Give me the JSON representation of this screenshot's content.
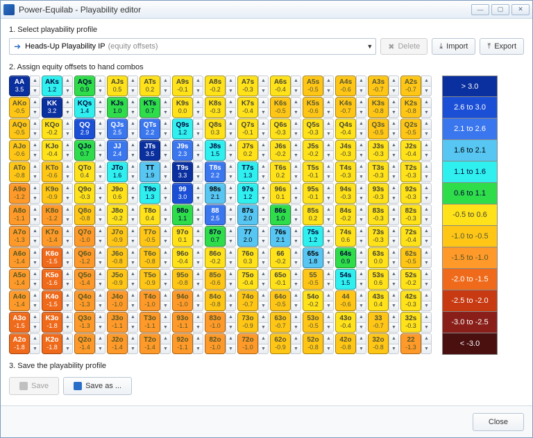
{
  "window": {
    "title": "Power-Equilab - Playability editor"
  },
  "section1": {
    "label": "1. Select playability profile",
    "profile_name": "Heads-Up Playability IP",
    "profile_suffix": "(equity offsets)",
    "delete_label": "Delete",
    "import_label": "Import",
    "export_label": "Export"
  },
  "section2": {
    "label": "2. Assign equity offsets to hand combos"
  },
  "section3": {
    "label": "3. Save the playability profile",
    "save_label": "Save",
    "saveas_label": "Save as ..."
  },
  "footer": {
    "close_label": "Close"
  },
  "legend": [
    {
      "label": "> 3.0",
      "v": 3.5
    },
    {
      "label": "2.6 to 3.0",
      "v": 2.8
    },
    {
      "label": "2.1 to 2.6",
      "v": 2.3
    },
    {
      "label": "1.6 to 2.1",
      "v": 1.8
    },
    {
      "label": "1.1 to 1.6",
      "v": 1.3
    },
    {
      "label": "0.6 to 1.1",
      "v": 0.8
    },
    {
      "label": "-0.5 to 0.6",
      "v": 0.0
    },
    {
      "label": "-1.0 to -0.5",
      "v": -0.7
    },
    {
      "label": "-1.5 to -1.0",
      "v": -1.2
    },
    {
      "label": "-2.0 to -1.5",
      "v": -1.7
    },
    {
      "label": "-2.5 to -2.0",
      "v": -2.2
    },
    {
      "label": "-3.0 to -2.5",
      "v": -2.7
    },
    {
      "label": "< -3.0",
      "v": -3.5
    }
  ],
  "chart_data": {
    "type": "heatmap",
    "title": "Equity offsets by hand combo",
    "rows": [
      "A",
      "K",
      "Q",
      "J",
      "T",
      "9",
      "8",
      "7",
      "6",
      "5",
      "4",
      "3",
      "2"
    ],
    "cols": [
      "A",
      "K",
      "Q",
      "J",
      "T",
      "9",
      "8",
      "7",
      "6",
      "5",
      "4",
      "3",
      "2"
    ],
    "note": "diagonal = pairs, upper-right = suited (s), lower-left = offsuit (o); value is equity offset",
    "grid": [
      [
        {
          "h": "AA",
          "v": 3.5
        },
        {
          "h": "AKs",
          "v": 1.2
        },
        {
          "h": "AQs",
          "v": 0.9
        },
        {
          "h": "AJs",
          "v": 0.5
        },
        {
          "h": "ATs",
          "v": 0.2
        },
        {
          "h": "A9s",
          "v": -0.1
        },
        {
          "h": "A8s",
          "v": -0.2
        },
        {
          "h": "A7s",
          "v": -0.3
        },
        {
          "h": "A6s",
          "v": -0.4
        },
        {
          "h": "A5s",
          "v": -0.5
        },
        {
          "h": "A4s",
          "v": -0.6
        },
        {
          "h": "A3s",
          "v": -0.7
        },
        {
          "h": "A2s",
          "v": -0.7
        }
      ],
      [
        {
          "h": "AKo",
          "v": -0.5
        },
        {
          "h": "KK",
          "v": 3.2
        },
        {
          "h": "KQs",
          "v": 1.4
        },
        {
          "h": "KJs",
          "v": 1.0
        },
        {
          "h": "KTs",
          "v": 0.7
        },
        {
          "h": "K9s",
          "v": 0.0
        },
        {
          "h": "K8s",
          "v": -0.3
        },
        {
          "h": "K7s",
          "v": -0.4
        },
        {
          "h": "K6s",
          "v": -0.5
        },
        {
          "h": "K5s",
          "v": -0.6
        },
        {
          "h": "K4s",
          "v": -0.7
        },
        {
          "h": "K3s",
          "v": -0.8
        },
        {
          "h": "K2s",
          "v": -0.8
        }
      ],
      [
        {
          "h": "AQo",
          "v": -0.5
        },
        {
          "h": "KQo",
          "v": -0.2
        },
        {
          "h": "QQ",
          "v": 2.9
        },
        {
          "h": "QJs",
          "v": 2.5
        },
        {
          "h": "QTs",
          "v": 2.2
        },
        {
          "h": "Q9s",
          "v": 1.2
        },
        {
          "h": "Q8s",
          "v": 0.3
        },
        {
          "h": "Q7s",
          "v": -0.1
        },
        {
          "h": "Q6s",
          "v": -0.3
        },
        {
          "h": "Q5s",
          "v": -0.3
        },
        {
          "h": "Q4s",
          "v": -0.4
        },
        {
          "h": "Q3s",
          "v": -0.5
        },
        {
          "h": "Q2s",
          "v": -0.5
        }
      ],
      [
        {
          "h": "AJo",
          "v": -0.6
        },
        {
          "h": "KJo",
          "v": -0.4
        },
        {
          "h": "QJo",
          "v": 0.7
        },
        {
          "h": "JJ",
          "v": 2.4
        },
        {
          "h": "JTs",
          "v": 3.5
        },
        {
          "h": "J9s",
          "v": 2.3
        },
        {
          "h": "J8s",
          "v": 1.5
        },
        {
          "h": "J7s",
          "v": 0.2
        },
        {
          "h": "J6s",
          "v": -0.2
        },
        {
          "h": "J5s",
          "v": -0.2
        },
        {
          "h": "J4s",
          "v": -0.3
        },
        {
          "h": "J3s",
          "v": -0.3
        },
        {
          "h": "J2s",
          "v": -0.4
        }
      ],
      [
        {
          "h": "ATo",
          "v": -0.8
        },
        {
          "h": "KTo",
          "v": -0.6
        },
        {
          "h": "QTo",
          "v": 0.4
        },
        {
          "h": "JTo",
          "v": 1.6
        },
        {
          "h": "TT",
          "v": 1.9
        },
        {
          "h": "T9s",
          "v": 3.3
        },
        {
          "h": "T8s",
          "v": 2.2
        },
        {
          "h": "T7s",
          "v": 1.3
        },
        {
          "h": "T6s",
          "v": 0.2
        },
        {
          "h": "T5s",
          "v": -0.1
        },
        {
          "h": "T4s",
          "v": -0.3
        },
        {
          "h": "T3s",
          "v": -0.3
        },
        {
          "h": "T2s",
          "v": -0.3
        }
      ],
      [
        {
          "h": "A9o",
          "v": -1.2
        },
        {
          "h": "K9o",
          "v": -0.9
        },
        {
          "h": "Q9o",
          "v": -0.3
        },
        {
          "h": "J9o",
          "v": 0.6
        },
        {
          "h": "T9o",
          "v": 1.3
        },
        {
          "h": "99",
          "v": 3.0
        },
        {
          "h": "98s",
          "v": 2.1
        },
        {
          "h": "97s",
          "v": 1.2
        },
        {
          "h": "96s",
          "v": 0.1
        },
        {
          "h": "95s",
          "v": -0.1
        },
        {
          "h": "94s",
          "v": -0.3
        },
        {
          "h": "93s",
          "v": -0.3
        },
        {
          "h": "92s",
          "v": -0.3
        }
      ],
      [
        {
          "h": "A8o",
          "v": -1.1
        },
        {
          "h": "K8o",
          "v": -1.2
        },
        {
          "h": "Q8o",
          "v": -0.8
        },
        {
          "h": "J8o",
          "v": -0.2
        },
        {
          "h": "T8o",
          "v": 0.4
        },
        {
          "h": "98o",
          "v": 1.1
        },
        {
          "h": "88",
          "v": 2.5
        },
        {
          "h": "87s",
          "v": 2.0
        },
        {
          "h": "86s",
          "v": 1.0
        },
        {
          "h": "85s",
          "v": 0.2
        },
        {
          "h": "84s",
          "v": -0.2
        },
        {
          "h": "83s",
          "v": -0.3
        },
        {
          "h": "82s",
          "v": -0.3
        }
      ],
      [
        {
          "h": "A7o",
          "v": -1.3
        },
        {
          "h": "K7o",
          "v": -1.4
        },
        {
          "h": "Q7o",
          "v": -1.0
        },
        {
          "h": "J7o",
          "v": -0.9
        },
        {
          "h": "T7o",
          "v": -0.5
        },
        {
          "h": "97o",
          "v": 0.1
        },
        {
          "h": "87o",
          "v": 0.7
        },
        {
          "h": "77",
          "v": 2.0
        },
        {
          "h": "76s",
          "v": 2.1
        },
        {
          "h": "75s",
          "v": 1.2
        },
        {
          "h": "74s",
          "v": 0.6
        },
        {
          "h": "73s",
          "v": -0.3
        },
        {
          "h": "72s",
          "v": -0.4
        }
      ],
      [
        {
          "h": "A6o",
          "v": -1.4
        },
        {
          "h": "K6o",
          "v": -1.5
        },
        {
          "h": "Q6o",
          "v": -1.2
        },
        {
          "h": "J6o",
          "v": -0.8
        },
        {
          "h": "T6o",
          "v": -0.8
        },
        {
          "h": "96o",
          "v": -0.4
        },
        {
          "h": "86o",
          "v": -0.2
        },
        {
          "h": "76o",
          "v": 0.3
        },
        {
          "h": "66",
          "v": -0.2
        },
        {
          "h": "65s",
          "v": 1.8
        },
        {
          "h": "64s",
          "v": 0.9
        },
        {
          "h": "63s",
          "v": 0.0
        },
        {
          "h": "62s",
          "v": -0.5
        }
      ],
      [
        {
          "h": "A5o",
          "v": -1.4
        },
        {
          "h": "K5o",
          "v": -1.6
        },
        {
          "h": "Q5o",
          "v": -1.4
        },
        {
          "h": "J5o",
          "v": -0.9
        },
        {
          "h": "T5o",
          "v": -0.9
        },
        {
          "h": "95o",
          "v": -0.8
        },
        {
          "h": "85o",
          "v": -0.6
        },
        {
          "h": "75o",
          "v": -0.4
        },
        {
          "h": "65o",
          "v": -0.1
        },
        {
          "h": "55",
          "v": -0.5
        },
        {
          "h": "54s",
          "v": 1.5
        },
        {
          "h": "53s",
          "v": 0.6
        },
        {
          "h": "52s",
          "v": -0.2
        }
      ],
      [
        {
          "h": "A4o",
          "v": -1.4
        },
        {
          "h": "K4o",
          "v": -1.5
        },
        {
          "h": "Q4o",
          "v": -1.3
        },
        {
          "h": "J4o",
          "v": -1.0
        },
        {
          "h": "T4o",
          "v": -1.0
        },
        {
          "h": "94o",
          "v": -1.0
        },
        {
          "h": "84o",
          "v": -0.8
        },
        {
          "h": "74o",
          "v": -0.7
        },
        {
          "h": "64o",
          "v": -0.5
        },
        {
          "h": "54o",
          "v": -0.2
        },
        {
          "h": "44",
          "v": -0.6
        },
        {
          "h": "43s",
          "v": 0.4
        },
        {
          "h": "42s",
          "v": -0.3
        }
      ],
      [
        {
          "h": "A3o",
          "v": -1.5
        },
        {
          "h": "K3o",
          "v": -1.8
        },
        {
          "h": "Q3o",
          "v": -1.3
        },
        {
          "h": "J3o",
          "v": -1.1
        },
        {
          "h": "T3o",
          "v": -1.1
        },
        {
          "h": "93o",
          "v": -1.1
        },
        {
          "h": "83o",
          "v": -1.0
        },
        {
          "h": "73o",
          "v": -0.9
        },
        {
          "h": "63o",
          "v": -0.7
        },
        {
          "h": "53o",
          "v": -0.5
        },
        {
          "h": "43o",
          "v": -0.4
        },
        {
          "h": "33",
          "v": -0.7
        },
        {
          "h": "32s",
          "v": -0.3
        }
      ],
      [
        {
          "h": "A2o",
          "v": -1.8
        },
        {
          "h": "K2o",
          "v": -1.8
        },
        {
          "h": "Q2o",
          "v": -1.4
        },
        {
          "h": "J2o",
          "v": -1.4
        },
        {
          "h": "T2o",
          "v": -1.4
        },
        {
          "h": "92o",
          "v": -1.1
        },
        {
          "h": "82o",
          "v": -1.0
        },
        {
          "h": "72o",
          "v": -1.0
        },
        {
          "h": "62o",
          "v": -0.9
        },
        {
          "h": "52o",
          "v": -0.8
        },
        {
          "h": "42o",
          "v": -0.8
        },
        {
          "h": "32o",
          "v": -0.8
        },
        {
          "h": "22",
          "v": -1.3
        }
      ]
    ]
  }
}
